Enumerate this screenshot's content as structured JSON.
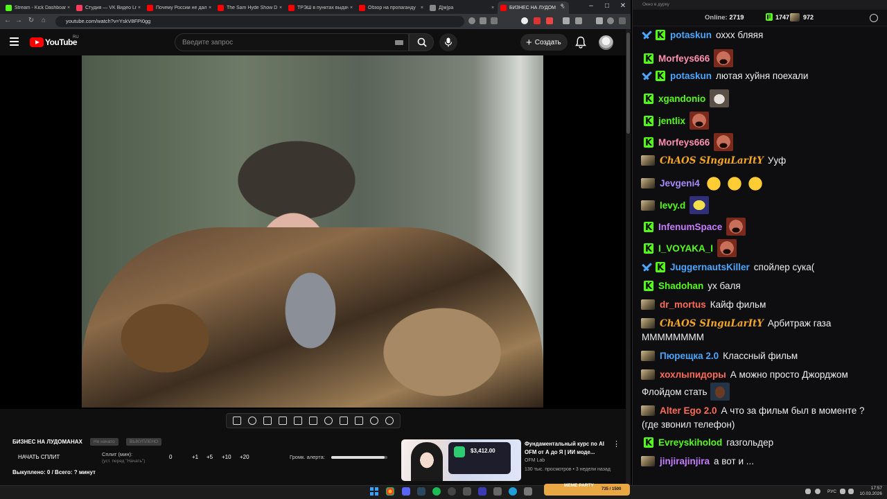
{
  "browser": {
    "tabs": [
      {
        "label": "Stream - Kick Dashboard",
        "color": "#53fc18"
      },
      {
        "label": "Студия — VK Видео Live",
        "color": "#ff3b5c"
      },
      {
        "label": "Почему России не дал",
        "color": "#ff0000"
      },
      {
        "label": "The Sam Hyde Show D",
        "color": "#ff0000"
      },
      {
        "label": "ТРЭШ в пунктах выдач",
        "color": "#ff0000"
      },
      {
        "label": "Обзор на пропаганду",
        "color": "#ff0000"
      },
      {
        "label": "Д[м]ра",
        "color": "#888888"
      },
      {
        "label": "БИЗНЕС НА ЛУДОМ",
        "color": "#ff0000"
      }
    ],
    "url": "youtube.com/watch?v=YskV8FPi0gg"
  },
  "youtube": {
    "logo_text": "YouTube",
    "country": "RU",
    "search_placeholder": "Введите запрос",
    "create_label": "Создать"
  },
  "split": {
    "title": "БИЗНЕС НА ЛУДОМАНАХ",
    "chip1": "Не начато",
    "chip2": "ВЫКУПЛЕНО",
    "start_label": "НАЧАТЬ СПЛИТ",
    "minutes_label": "Сплит (мин):",
    "minutes_hint": "(уст. перед \"Начать\")",
    "value": "0",
    "increments": [
      "+1",
      "+5",
      "+10",
      "+20"
    ],
    "alert_volume_label": "Громк. алерта:",
    "alert_volume": 0.95,
    "bought_line": "Выкуплено: 0 / Всего: ? минут"
  },
  "recommended": {
    "title": "Фундаментальный курс по AI OFM от А до Я | ИИ моде...",
    "channel": "OFM Lab",
    "meta": "130 тыс. просмотров • 3 недели назад",
    "thumb_amount": "$3,412.00"
  },
  "chat": {
    "window_title": "Окно в дурку",
    "online_label": "Online:",
    "online_count": "2719",
    "stat1": "1747",
    "stat2": "972",
    "messages": [
      {
        "user": "potaskun",
        "color": "#4aa6ff",
        "text": "оххх бляяя",
        "mod": true
      },
      {
        "user": "Morfeys666",
        "color": "#ff8fb0",
        "text": "",
        "emote": "face"
      },
      {
        "user": "potaskun",
        "color": "#4aa6ff",
        "text": "лютая хуйня поехали",
        "mod": true
      },
      {
        "user": "xgandonio",
        "color": "#53fc18",
        "text": "",
        "emote": "cat"
      },
      {
        "user": "jentlix",
        "color": "#53fc18",
        "text": "",
        "emote": "face"
      },
      {
        "user": "Morfeys666",
        "color": "#ff8fb0",
        "text": "",
        "emote": "face"
      },
      {
        "user": "ChAOS SInguLarItY",
        "color": "#f5a623",
        "text": "Ууф",
        "avatar": true
      },
      {
        "user": "Jevgeni4",
        "color": "#a78bfa",
        "text": "",
        "avatar": true,
        "emote": "laugh3"
      },
      {
        "user": "levy.d",
        "color": "#53fc18",
        "text": "",
        "avatar": true,
        "emote": "yellow"
      },
      {
        "user": "InfenumSpace",
        "color": "#c77dff",
        "text": "",
        "emote": "face"
      },
      {
        "user": "I_VOYAKA_I",
        "color": "#53fc18",
        "text": "",
        "emote": "face"
      },
      {
        "user": "JuggernautsKiller",
        "color": "#4aa6ff",
        "text": "спойлер сука(",
        "mod": true
      },
      {
        "user": "Shadohan",
        "color": "#53fc18",
        "text": "ух баля"
      },
      {
        "user": "dr_mortus",
        "color": "#ff6b57",
        "text": "Кайф фильм",
        "avatar": true
      },
      {
        "user": "ChAOS SInguLarItY",
        "color": "#f5a623",
        "text": "Арбитраж газа",
        "avatar": true,
        "cont": "ММММММММ"
      },
      {
        "user": "Пюрещка 2.0",
        "color": "#4aa6ff",
        "text": "Классный фильм",
        "avatar": true
      },
      {
        "user": "хохлыпидоры",
        "color": "#ff6b57",
        "text": "А можно просто Джорджом",
        "avatar": true,
        "cont": "Флойдом стать"
      },
      {
        "user": "Alter Ego 2.0",
        "color": "#ff6b57",
        "text": "А что за фильм был в моменте ?",
        "avatar": true,
        "cont": "(где звонил телефон)"
      },
      {
        "user": "Evreyskiholod",
        "color": "#53fc18",
        "text": "газгольдер"
      },
      {
        "user": "jinjirajinjira",
        "color": "#c77dff",
        "text": "а вот и ...",
        "avatar": true
      }
    ]
  },
  "taskbar": {
    "meme_label": "MEME PARTY",
    "meme_count": "735 / 1500",
    "lang": "РУС",
    "time": "17:57",
    "date": "10.03.2026"
  }
}
